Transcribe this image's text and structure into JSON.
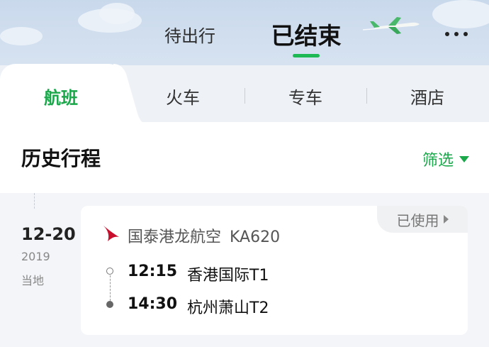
{
  "header": {
    "segments": [
      {
        "label": "待出行",
        "active": false
      },
      {
        "label": "已结束",
        "active": true
      }
    ],
    "accent_color": "#1db954"
  },
  "tabs": [
    {
      "label": "航班",
      "active": true
    },
    {
      "label": "火车",
      "active": false
    },
    {
      "label": "专车",
      "active": false
    },
    {
      "label": "酒店",
      "active": false
    }
  ],
  "section": {
    "title": "历史行程",
    "filter_label": "筛选"
  },
  "trip": {
    "date": "12-20",
    "year": "2019",
    "local_label": "当地",
    "status": "已使用",
    "airline": "国泰港龙航空",
    "flight_no": "KA620",
    "departure": {
      "time": "12:15",
      "place": "香港国际T1"
    },
    "arrival": {
      "time": "14:30",
      "place": "杭州萧山T2"
    }
  },
  "colors": {
    "brand_green": "#1aa84b",
    "airline_red": "#c8102e"
  },
  "icons": [
    "airplane-icon",
    "more-icon",
    "dropdown-triangle-icon",
    "chevron-right-icon",
    "airline-logo-icon"
  ]
}
